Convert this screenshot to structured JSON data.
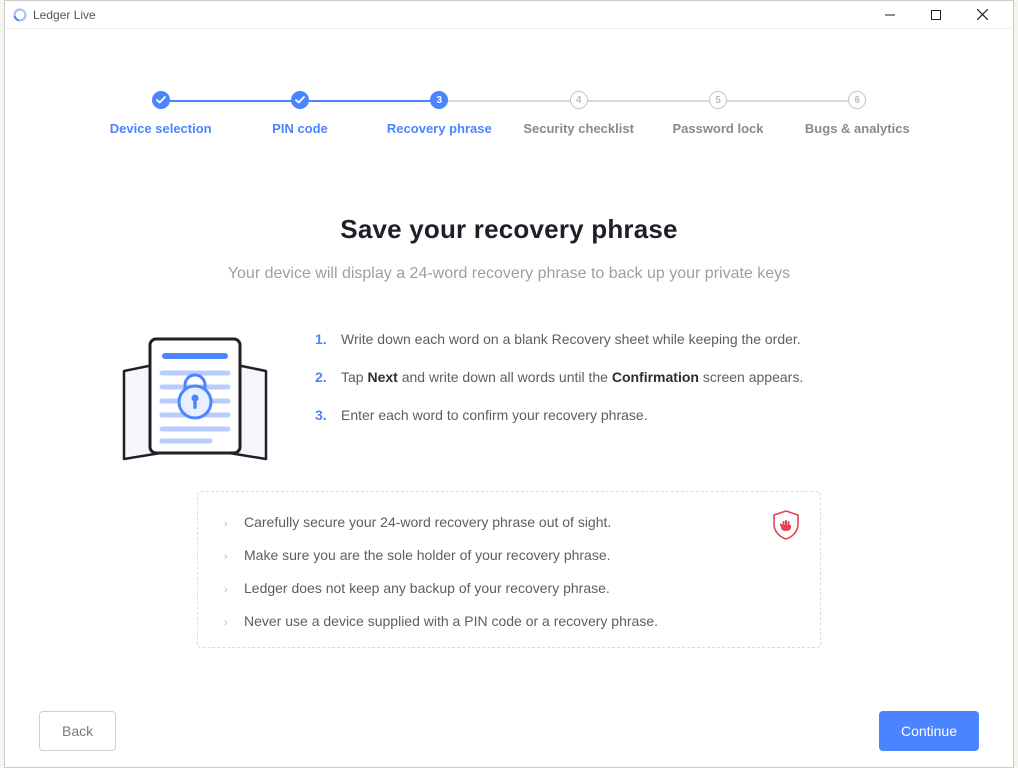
{
  "window": {
    "title": "Ledger Live"
  },
  "stepper": {
    "steps": [
      {
        "label": "Device selection",
        "state": "done"
      },
      {
        "label": "PIN code",
        "state": "done"
      },
      {
        "label": "Recovery phrase",
        "state": "current",
        "number": "3"
      },
      {
        "label": "Security checklist",
        "state": "pending",
        "number": "4"
      },
      {
        "label": "Password lock",
        "state": "pending",
        "number": "5"
      },
      {
        "label": "Bugs & analytics",
        "state": "pending",
        "number": "6"
      }
    ]
  },
  "main": {
    "heading": "Save your recovery phrase",
    "subheading": "Your device will display a 24-word recovery phrase to back up your private keys",
    "instructions": [
      {
        "pre": "Write down each word on a blank Recovery sheet while keeping the order."
      },
      {
        "pre": "Tap ",
        "b1": "Next",
        "mid": " and write down all words until the ",
        "b2": "Confirmation",
        "post": " screen appears."
      },
      {
        "pre": "Enter each word to confirm your recovery phrase."
      }
    ],
    "warnings": [
      "Carefully secure your 24-word recovery phrase out of sight.",
      "Make sure you are the sole holder of your recovery phrase.",
      "Ledger does not keep any backup of your recovery phrase.",
      "Never use a device supplied with a PIN code or a recovery phrase."
    ]
  },
  "footer": {
    "back": "Back",
    "continue": "Continue"
  },
  "colors": {
    "accent": "#4b84ff",
    "danger": "#e64254"
  }
}
